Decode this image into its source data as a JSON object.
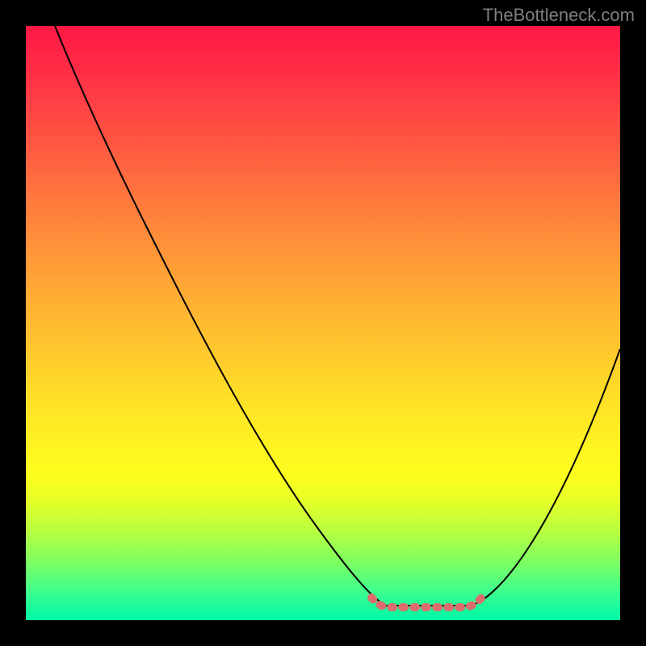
{
  "watermark": "TheBottleneck.com",
  "chart_data": {
    "type": "line",
    "title": "",
    "xlabel": "",
    "ylabel": "",
    "xlim": [
      0,
      100
    ],
    "ylim": [
      0,
      100
    ],
    "gradient_background": {
      "top_color": "#ff1846",
      "mid_color": "#fff620",
      "bottom_color": "#00f7a8"
    },
    "series": [
      {
        "name": "curve",
        "x": [
          5,
          10,
          15,
          20,
          25,
          30,
          35,
          40,
          45,
          50,
          55,
          58,
          60,
          63,
          65,
          70,
          75,
          80,
          85,
          90,
          95,
          100
        ],
        "y": [
          100,
          91,
          82,
          73,
          64,
          55,
          46,
          37,
          28,
          19,
          10,
          5,
          3,
          2,
          2,
          2,
          3,
          7,
          15,
          26,
          40,
          57
        ]
      }
    ],
    "highlighted_region": {
      "name": "bottleneck-optimal-range",
      "x_start": 58,
      "x_end": 77,
      "y": 2,
      "style": "dotted",
      "color": "#de6c6c"
    }
  }
}
